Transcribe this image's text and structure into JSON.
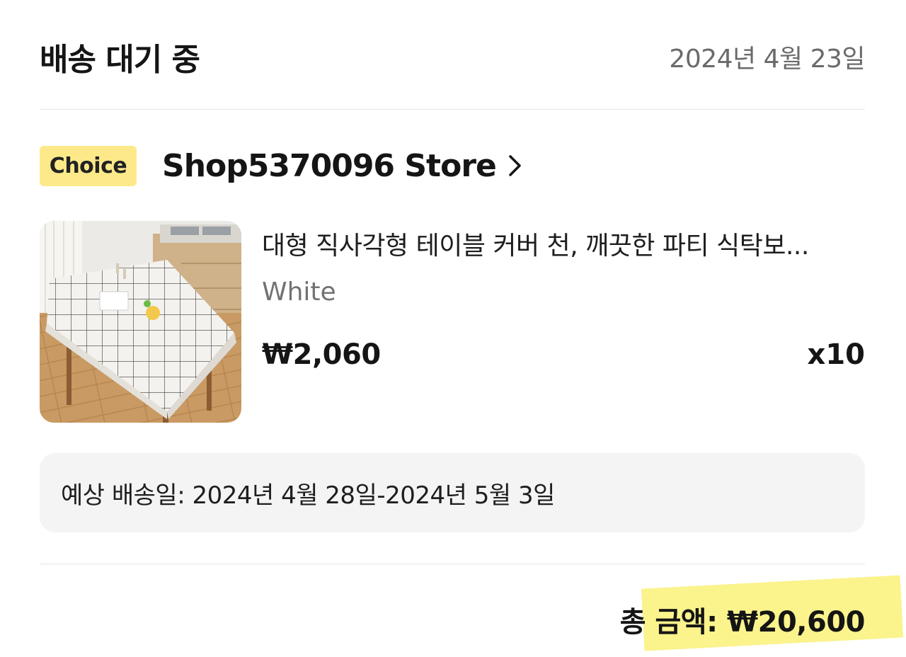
{
  "order": {
    "status": "배송 대기 중",
    "date": "2024년 4월 23일"
  },
  "store": {
    "badge": "Choice",
    "name": "Shop5370096 Store",
    "badge_color": "#fde98a"
  },
  "item": {
    "title": "대형 직사각형 테이블 커버 천, 깨끗한 파티 식탁보...",
    "variant": "White",
    "price": "₩2,060",
    "quantity": "x10",
    "image_icon": "product-photo-tablecloth"
  },
  "delivery": {
    "estimate": "예상 배송일: 2024년 4월 28일-2024년 5월 3일"
  },
  "total": {
    "text": "총 금액: ₩20,600",
    "highlight_color": "#fbf286"
  }
}
